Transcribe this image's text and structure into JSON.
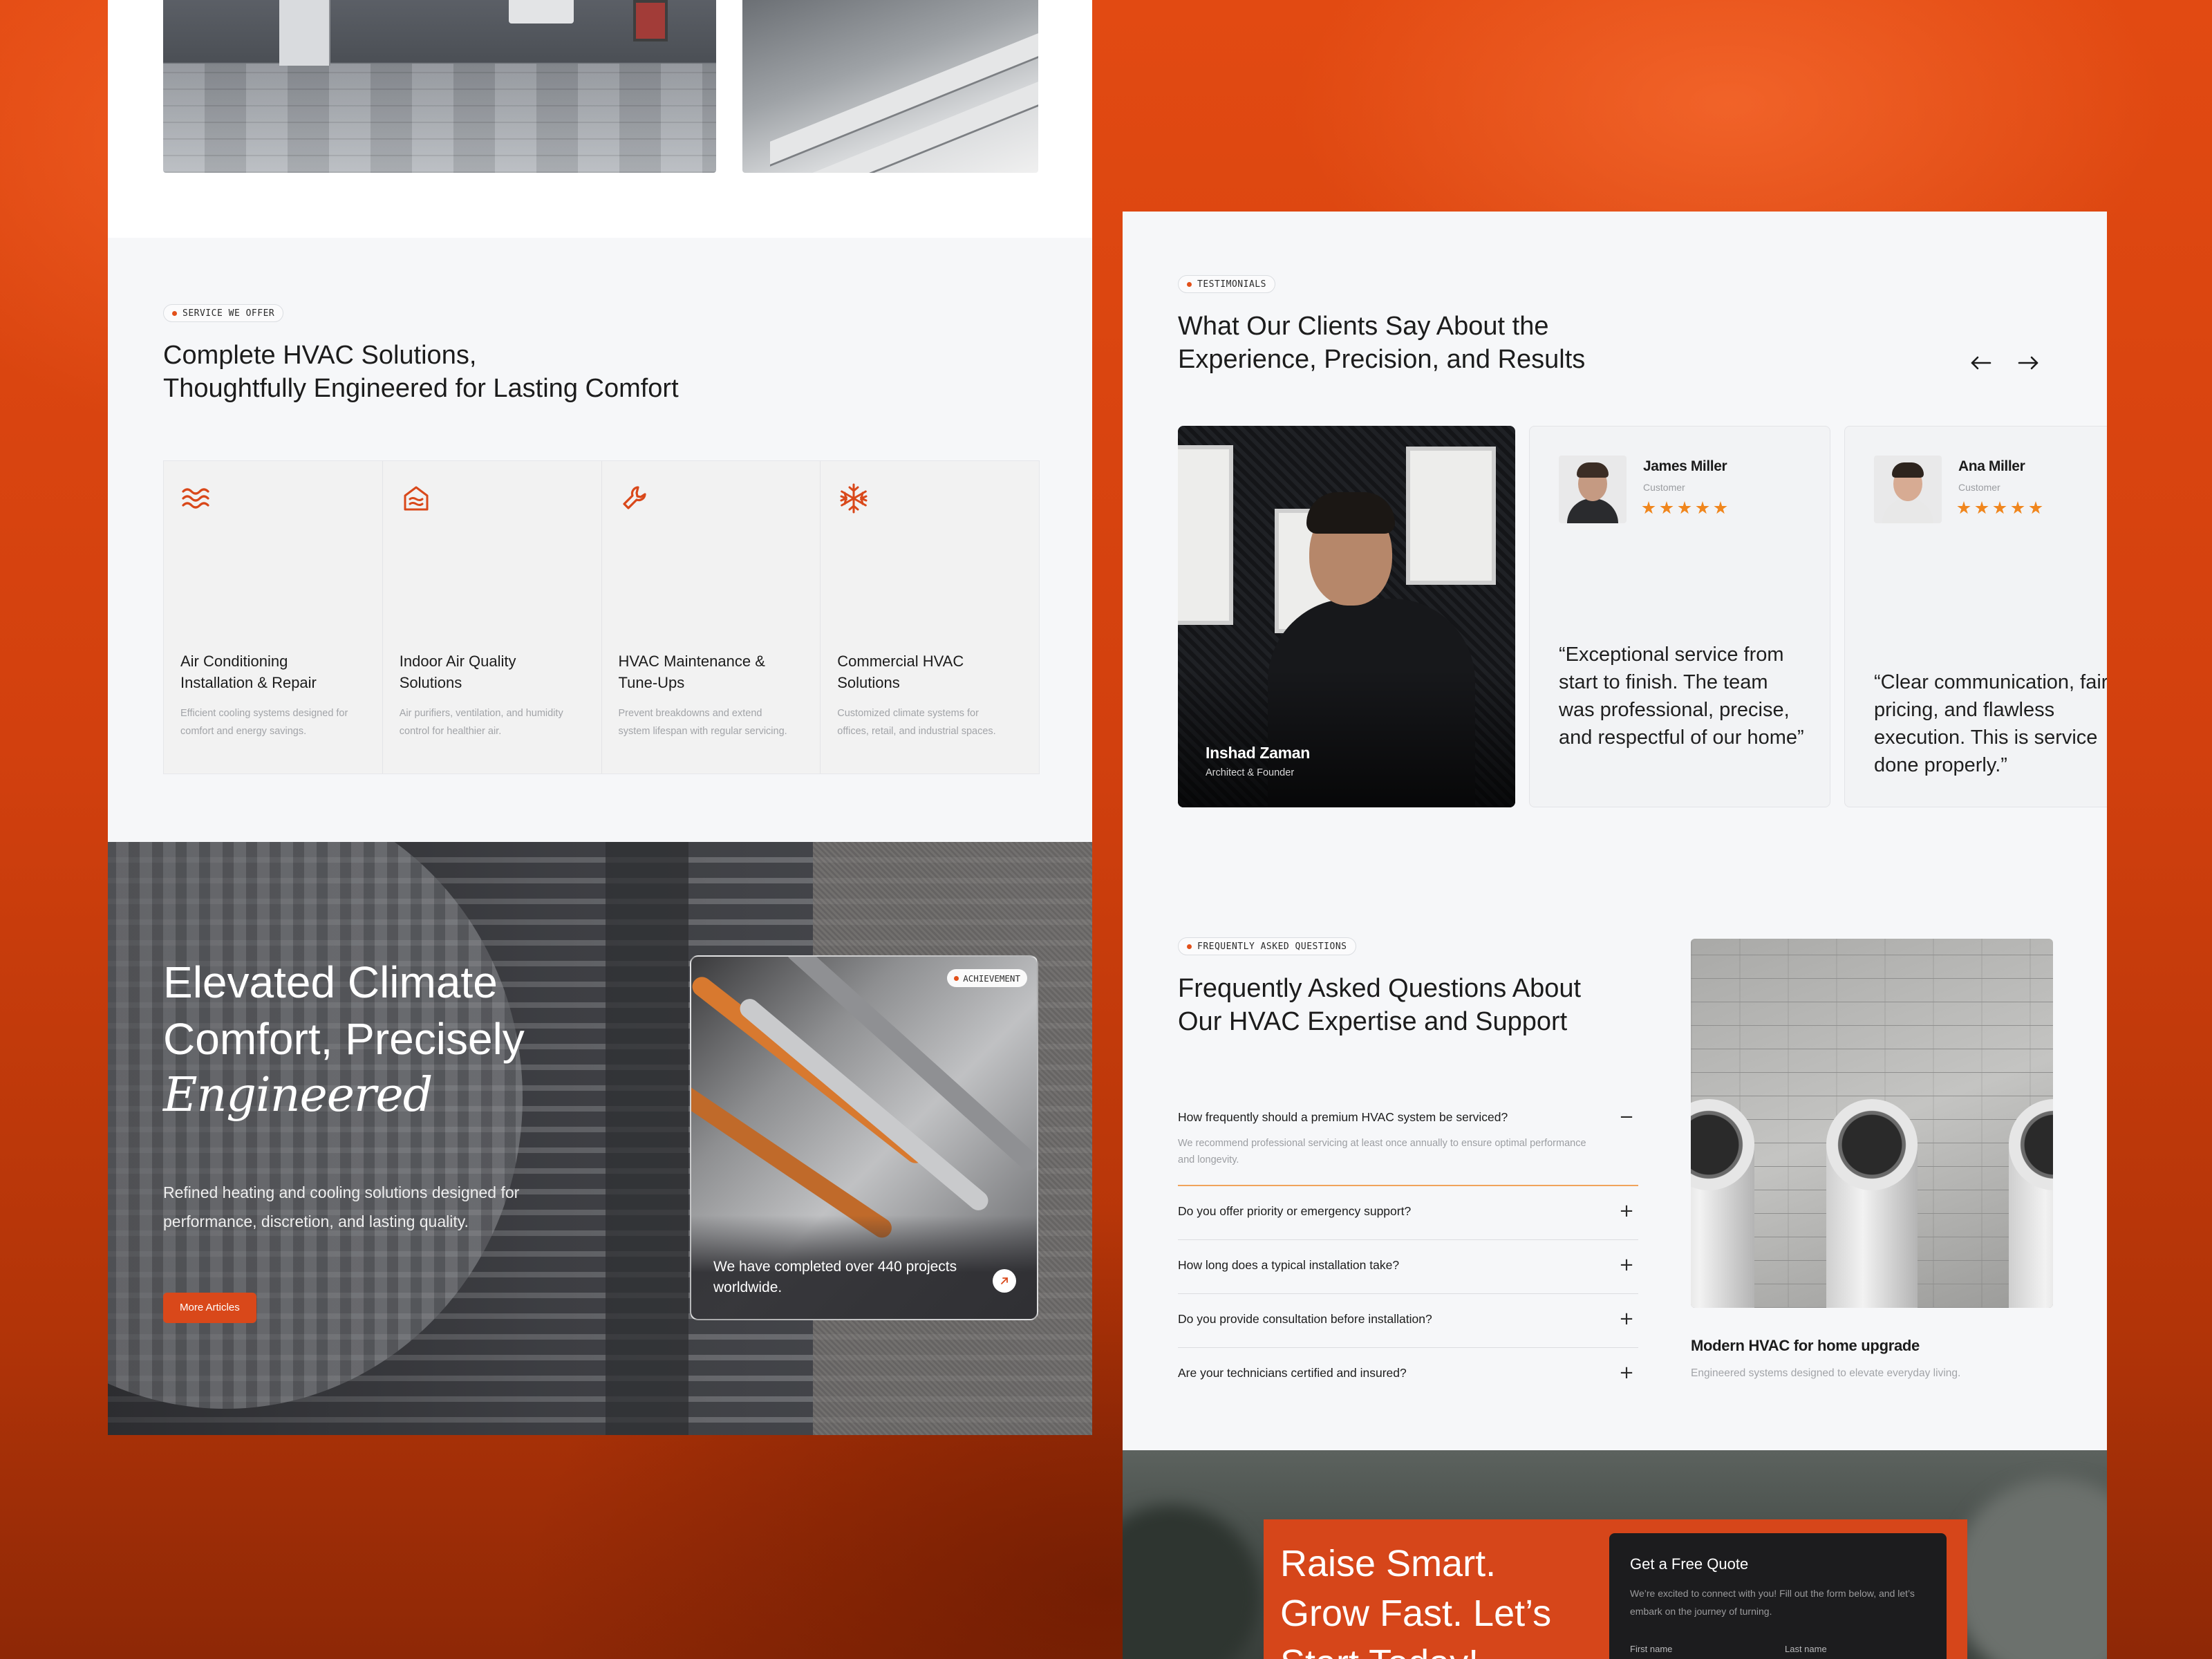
{
  "colors": {
    "accent": "#d9481a",
    "star": "#f0861d",
    "faq_active": "#f0a35c"
  },
  "services": {
    "tag": "SERVICE WE OFFER",
    "title_line1": "Complete HVAC Solutions,",
    "title_line2": "Thoughtfully Engineered for Lasting Comfort",
    "items": [
      {
        "icon": "waves-icon",
        "title": "Air Conditioning Installation & Repair",
        "desc": "Efficient cooling systems designed for comfort and energy savings."
      },
      {
        "icon": "house-air-icon",
        "title": "Indoor Air Quality Solutions",
        "desc": "Air purifiers, ventilation, and humidity control for healthier air."
      },
      {
        "icon": "wrench-icon",
        "title": "HVAC Maintenance & Tune-Ups",
        "desc": "Prevent breakdowns and extend system lifespan with regular servicing."
      },
      {
        "icon": "snowflake-icon",
        "title": "Commercial HVAC Solutions",
        "desc": "Customized climate systems for offices, retail, and industrial spaces."
      }
    ]
  },
  "hero": {
    "title_line1": "Elevated Climate",
    "title_line2": "Comfort, Precisely",
    "title_italic": "Engineered",
    "paragraph": "Refined heating and cooling solutions designed for performance, discretion, and lasting quality.",
    "button": "More Articles",
    "achievement_tag": "ACHIEVEMENT",
    "achievement_text": "We have completed over 440 projects worldwide.",
    "achievement_icon": "arrow-up-right-icon"
  },
  "testimonials": {
    "tag": "TESTIMONIALS",
    "title_line1": "What Our Clients Say About the",
    "title_line2": "Experience, Precision, and Results",
    "prev_icon": "arrow-left-icon",
    "next_icon": "arrow-right-icon",
    "featured": {
      "name": "Inshad Zaman",
      "role": "Architect & Founder"
    },
    "cards": [
      {
        "name": "James Miller",
        "role": "Customer",
        "rating": 5,
        "quote": "“Exceptional service from start to finish. The team was professional, precise, and respectful of our home”"
      },
      {
        "name": "Ana Miller",
        "role": "Customer",
        "rating": 5,
        "quote": "“Clear communication, fair pricing, and flawless execution. This is service done properly.”"
      }
    ]
  },
  "faq": {
    "tag": "FREQUENTLY ASKED QUESTIONS",
    "title_line1": "Frequently Asked Questions About",
    "title_line2": "Our HVAC Expertise and Support",
    "items": [
      {
        "q": "How frequently should a premium HVAC system be serviced?",
        "a": "We recommend professional servicing at least once annually to ensure optimal performance and longevity.",
        "open": true,
        "toggle": "−"
      },
      {
        "q": "Do you offer priority or emergency support?",
        "toggle": "+"
      },
      {
        "q": "How long does a typical installation take?",
        "toggle": "+"
      },
      {
        "q": "Do you provide consultation before installation?",
        "toggle": "+"
      },
      {
        "q": "Are your technicians certified and insured?",
        "toggle": "+"
      }
    ],
    "image_caption": "Modern HVAC for home upgrade",
    "image_sub": "Engineered systems designed to elevate everyday living."
  },
  "cta": {
    "title_line1": "Raise Smart.",
    "title_line2": "Grow Fast. Let’s",
    "title_line3": "Start Today!",
    "form_title": "Get a Free Quote",
    "form_sub": "We’re excited to connect with you! Fill out the form below, and let’s embark on the journey of turning.",
    "first_name_label": "First name",
    "last_name_label": "Last name"
  }
}
